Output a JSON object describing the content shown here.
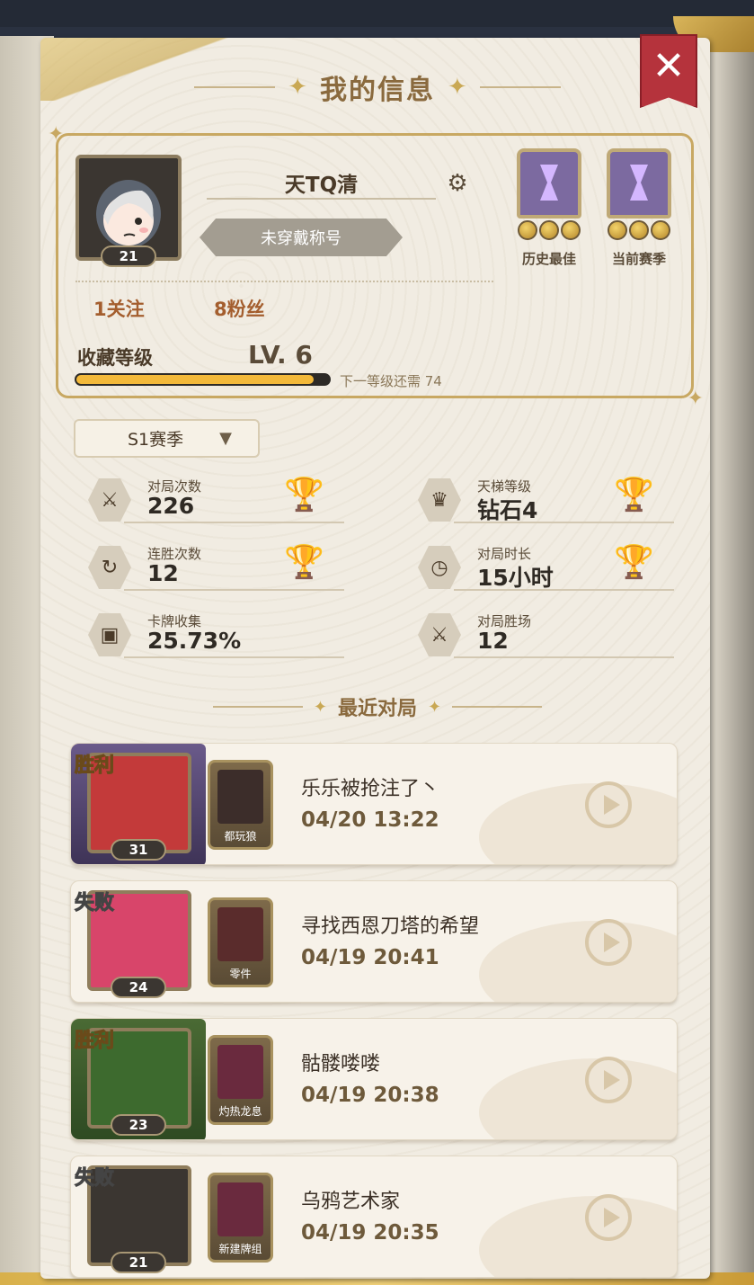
{
  "dialog": {
    "title": "我的信息",
    "close_icon": "close-icon"
  },
  "profile": {
    "username": "天TQ清",
    "level": "21",
    "title_badge": "未穿戴称号",
    "following": "1关注",
    "fans": "8粉丝",
    "collection_label": "收藏等级",
    "collection_level": "LV. 6",
    "collection_progress": 0.94,
    "next_level_text": "下一等级还需 74",
    "ranks": [
      {
        "label": "历史最佳"
      },
      {
        "label": "当前赛季"
      }
    ]
  },
  "season": {
    "selected": "S1赛季",
    "dropdown_icon": "caret-down-icon"
  },
  "stats": [
    {
      "label": "对局次数",
      "value": "226",
      "icon": "swords-icon"
    },
    {
      "label": "天梯等级",
      "value": "钻石4",
      "icon": "crown-icon"
    },
    {
      "label": "连胜次数",
      "value": "12",
      "icon": "streak-icon"
    },
    {
      "label": "对局时长",
      "value": "15小时",
      "icon": "clock-icon"
    },
    {
      "label": "卡牌收集",
      "value": "25.73%",
      "icon": "card-icon"
    },
    {
      "label": "对局胜场",
      "value": "12",
      "icon": "swords-icon"
    }
  ],
  "recent": {
    "title": "最近对局",
    "matches": [
      {
        "result": "胜利",
        "level": "31",
        "deck": "都玩狼",
        "opponent": "乐乐被抢注了丶",
        "time": "04/20 13:22"
      },
      {
        "result": "失败",
        "level": "24",
        "deck": "零件",
        "opponent": "寻找西恩刀塔的希望",
        "time": "04/19 20:41"
      },
      {
        "result": "胜利",
        "level": "23",
        "deck": "灼热龙息",
        "opponent": "骷髅喽喽",
        "time": "04/19 20:38"
      },
      {
        "result": "失败",
        "level": "21",
        "deck": "新建牌组",
        "opponent": "乌鸦艺术家",
        "time": "04/19 20:35"
      }
    ]
  }
}
